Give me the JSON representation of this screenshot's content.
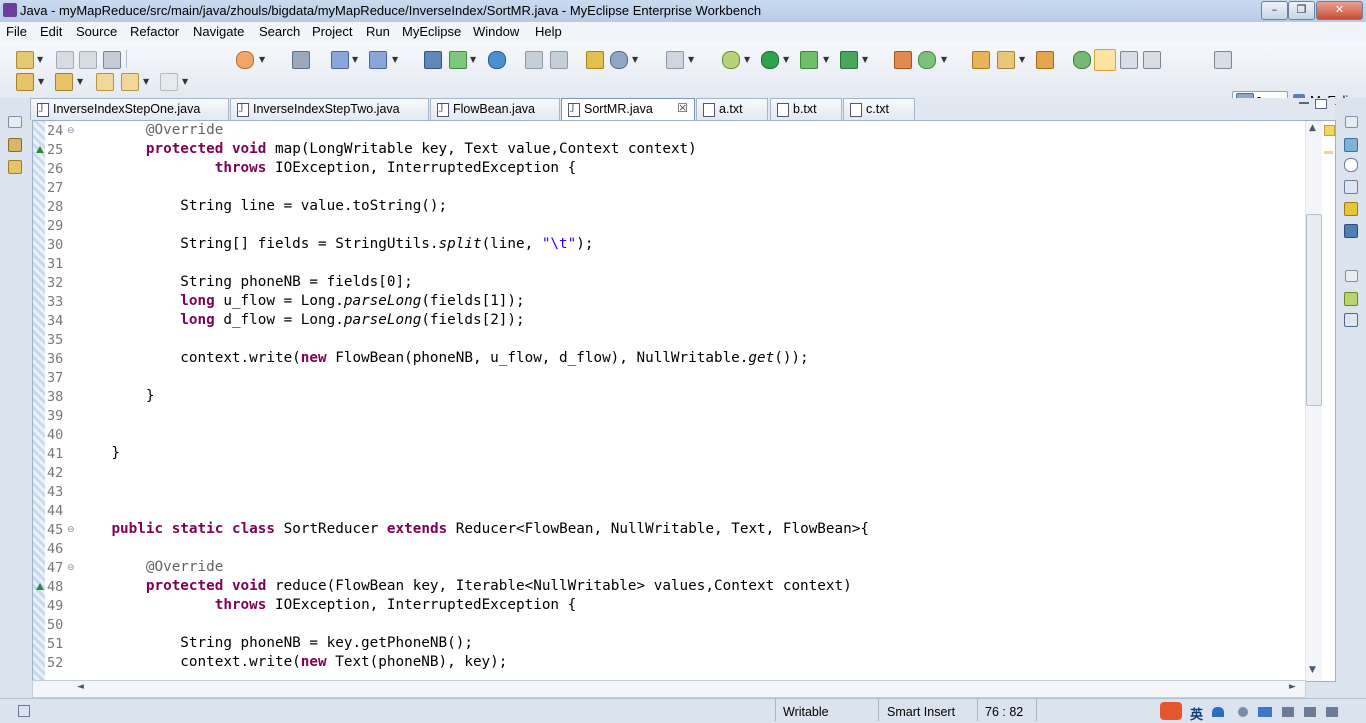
{
  "window": {
    "title": "Java - myMapReduce/src/main/java/zhouls/bigdata/myMapReduce/InverseIndex/SortMR.java - MyEclipse Enterprise Workbench",
    "controls": {
      "minimize": "–",
      "maximize": "❐",
      "close": "✕"
    }
  },
  "menu": [
    "File",
    "Edit",
    "Source",
    "Refactor",
    "Navigate",
    "Search",
    "Project",
    "Run",
    "MyEclipse",
    "Window",
    "Help"
  ],
  "perspectives": {
    "java": "Java",
    "myeclipse": "MyEcli"
  },
  "tabs": [
    {
      "label": "InverseIndexStepOne.java",
      "type": "java",
      "active": false
    },
    {
      "label": "InverseIndexStepTwo.java",
      "type": "java",
      "active": false
    },
    {
      "label": "FlowBean.java",
      "type": "java",
      "active": false
    },
    {
      "label": "SortMR.java",
      "type": "java",
      "active": true,
      "close": "☒"
    },
    {
      "label": "a.txt",
      "type": "txt",
      "active": false
    },
    {
      "label": "b.txt",
      "type": "txt",
      "active": false
    },
    {
      "label": "c.txt",
      "type": "txt",
      "active": false
    }
  ],
  "code": [
    {
      "n": "24",
      "fold": "⊖",
      "html": "        <span class='an'>@Override</span>"
    },
    {
      "n": "25",
      "marker": "override",
      "html": "        <span class='kw'>protected</span> <span class='kw'>void</span> map(LongWritable key, Text value,Context context)"
    },
    {
      "n": "26",
      "html": "                <span class='kw'>throws</span> IOException, InterruptedException {"
    },
    {
      "n": "27",
      "html": ""
    },
    {
      "n": "28",
      "html": "            String line = value.toString();"
    },
    {
      "n": "29",
      "html": ""
    },
    {
      "n": "30",
      "html": "            String[] fields = StringUtils.<span class='it'>split</span>(line, <span class='st'>\"\\t\"</span>);"
    },
    {
      "n": "31",
      "html": ""
    },
    {
      "n": "32",
      "html": "            String phoneNB = fields[0];"
    },
    {
      "n": "33",
      "html": "            <span class='kw'>long</span> u_flow = Long.<span class='it'>parseLong</span>(fields[1]);"
    },
    {
      "n": "34",
      "html": "            <span class='kw'>long</span> d_flow = Long.<span class='it'>parseLong</span>(fields[2]);"
    },
    {
      "n": "35",
      "html": ""
    },
    {
      "n": "36",
      "html": "            context.write(<span class='kw'>new</span> FlowBean(phoneNB, u_flow, d_flow), NullWritable.<span class='it'>get</span>());"
    },
    {
      "n": "37",
      "html": ""
    },
    {
      "n": "38",
      "html": "        }"
    },
    {
      "n": "39",
      "html": ""
    },
    {
      "n": "40",
      "html": ""
    },
    {
      "n": "41",
      "html": "    }"
    },
    {
      "n": "42",
      "html": ""
    },
    {
      "n": "43",
      "html": ""
    },
    {
      "n": "44",
      "html": ""
    },
    {
      "n": "45",
      "fold": "⊖",
      "html": "    <span class='kw'>public</span> <span class='kw'>static</span> <span class='kw'>class</span> SortReducer <span class='kw'>extends</span> Reducer&lt;FlowBean, NullWritable, Text, FlowBean&gt;{"
    },
    {
      "n": "46",
      "html": ""
    },
    {
      "n": "47",
      "fold": "⊖",
      "html": "        <span class='an'>@Override</span>"
    },
    {
      "n": "48",
      "marker": "override",
      "html": "        <span class='kw'>protected</span> <span class='kw'>void</span> reduce(FlowBean key, Iterable&lt;NullWritable&gt; values,Context context)"
    },
    {
      "n": "49",
      "html": "                <span class='kw'>throws</span> IOException, InterruptedException {"
    },
    {
      "n": "50",
      "html": ""
    },
    {
      "n": "51",
      "html": "            String phoneNB = key.getPhoneNB();"
    },
    {
      "n": "52",
      "html": "            context.write(<span class='kw'>new</span> Text(phoneNB), key);"
    }
  ],
  "status": {
    "writable": "Writable",
    "insert_mode": "Smart Insert",
    "position": "76 : 82"
  },
  "tray": {
    "ime": "英"
  }
}
